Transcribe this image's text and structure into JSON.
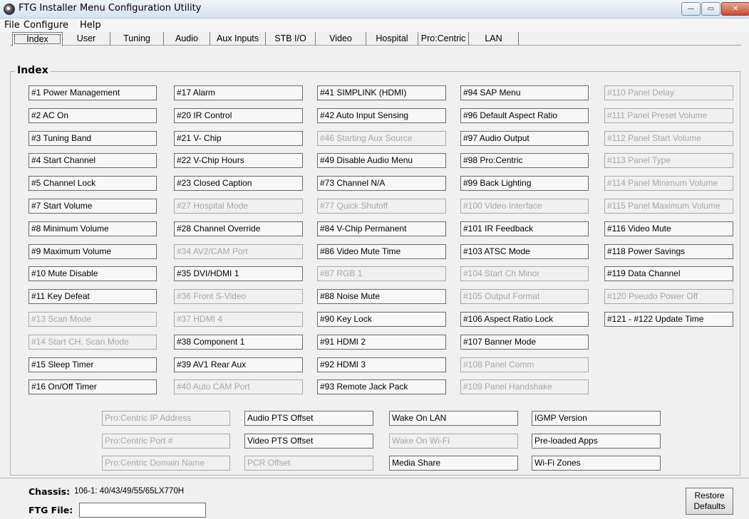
{
  "window": {
    "title": "FTG Installer Menu Configuration Utility",
    "min": "—",
    "max": "▭",
    "close": "✕"
  },
  "menu": [
    "File",
    "Configure",
    "Help"
  ],
  "tabs": [
    "Index",
    "User",
    "Tuning",
    "Audio",
    "Aux Inputs",
    "STB I/O",
    "Video",
    "Hospital",
    "Pro:Centric",
    "LAN"
  ],
  "group_title": "Index",
  "columns": [
    [
      {
        "label": "#1 Power Management",
        "enabled": true
      },
      {
        "label": "#2 AC On",
        "enabled": true
      },
      {
        "label": "#3 Tuning Band",
        "enabled": true
      },
      {
        "label": "#4 Start Channel",
        "enabled": true
      },
      {
        "label": "#5 Channel Lock",
        "enabled": true
      },
      {
        "label": "#7 Start Volume",
        "enabled": true
      },
      {
        "label": "#8 Minimum Volume",
        "enabled": true
      },
      {
        "label": "#9 Maximum Volume",
        "enabled": true
      },
      {
        "label": "#10 Mute Disable",
        "enabled": true
      },
      {
        "label": "#11 Key Defeat",
        "enabled": true
      },
      {
        "label": "#13 Scan Mode",
        "enabled": false
      },
      {
        "label": "#14 Start CH, Scan Mode",
        "enabled": false
      },
      {
        "label": "#15 Sleep Timer",
        "enabled": true
      },
      {
        "label": "#16 On/Off Timer",
        "enabled": true
      }
    ],
    [
      {
        "label": "#17 Alarm",
        "enabled": true
      },
      {
        "label": "#20 IR Control",
        "enabled": true
      },
      {
        "label": "#21 V- Chip",
        "enabled": true
      },
      {
        "label": "#22 V-Chip Hours",
        "enabled": true
      },
      {
        "label": "#23 Closed Caption",
        "enabled": true
      },
      {
        "label": "#27 Hospital Mode",
        "enabled": false
      },
      {
        "label": "#28 Channel Override",
        "enabled": true
      },
      {
        "label": "#34 AV2/CAM Port",
        "enabled": false
      },
      {
        "label": "#35 DVI/HDMI 1",
        "enabled": true
      },
      {
        "label": "#36 Front S-Video",
        "enabled": false
      },
      {
        "label": "#37 HDMI 4",
        "enabled": false
      },
      {
        "label": "#38 Component 1",
        "enabled": true
      },
      {
        "label": "#39 AV1 Rear Aux",
        "enabled": true
      },
      {
        "label": "#40 Auto CAM Port",
        "enabled": false
      }
    ],
    [
      {
        "label": "#41 SIMPLINK (HDMI)",
        "enabled": true
      },
      {
        "label": "#42 Auto Input Sensing",
        "enabled": true
      },
      {
        "label": "#46 Starting Aux Source",
        "enabled": false
      },
      {
        "label": "#49 Disable Audio Menu",
        "enabled": true
      },
      {
        "label": "#73 Channel N/A",
        "enabled": true
      },
      {
        "label": "#77 Quick Shutoff",
        "enabled": false
      },
      {
        "label": "#84 V-Chip Permanent",
        "enabled": true
      },
      {
        "label": "#86 Video Mute Time",
        "enabled": true
      },
      {
        "label": "#87 RGB 1",
        "enabled": false
      },
      {
        "label": "#88 Noise Mute",
        "enabled": true
      },
      {
        "label": "#90 Key Lock",
        "enabled": true
      },
      {
        "label": "#91 HDMI 2",
        "enabled": true
      },
      {
        "label": "#92 HDMI 3",
        "enabled": true
      },
      {
        "label": "#93 Remote Jack Pack",
        "enabled": true
      }
    ],
    [
      {
        "label": "#94 SAP Menu",
        "enabled": true
      },
      {
        "label": "#96 Default Aspect Ratio",
        "enabled": true
      },
      {
        "label": "#97 Audio Output",
        "enabled": true
      },
      {
        "label": "#98 Pro:Centric",
        "enabled": true
      },
      {
        "label": "#99 Back Lighting",
        "enabled": true
      },
      {
        "label": "#100 Video Interface",
        "enabled": false
      },
      {
        "label": "#101 IR Feedback",
        "enabled": true
      },
      {
        "label": "#103 ATSC Mode",
        "enabled": true
      },
      {
        "label": "#104 Start Ch Minor",
        "enabled": false
      },
      {
        "label": "#105 Output Format",
        "enabled": false
      },
      {
        "label": "#106 Aspect Ratio Lock",
        "enabled": true
      },
      {
        "label": "#107 Banner Mode",
        "enabled": true
      },
      {
        "label": "#108 Panel Comm",
        "enabled": false
      },
      {
        "label": "#109 Panel Handshake",
        "enabled": false
      }
    ],
    [
      {
        "label": "#110 Panel Delay",
        "enabled": false
      },
      {
        "label": "#111 Panel Preset Volume",
        "enabled": false
      },
      {
        "label": "#112 Panel Start Volume",
        "enabled": false
      },
      {
        "label": "#113 Panel Type",
        "enabled": false
      },
      {
        "label": "#114 Panel Minimum Volume",
        "enabled": false
      },
      {
        "label": "#115 Panel Maximum Volume",
        "enabled": false
      },
      {
        "label": "#116 Video Mute",
        "enabled": true
      },
      {
        "label": "#118 Power Savings",
        "enabled": true
      },
      {
        "label": "#119 Data Channel",
        "enabled": true
      },
      {
        "label": "#120 Pseudo Power Off",
        "enabled": false
      },
      {
        "label": "#121 - #122 Update Time",
        "enabled": true
      }
    ]
  ],
  "extra_columns": [
    [
      {
        "label": "Pro:Centric IP Address",
        "enabled": false
      },
      {
        "label": "Pro:Centric Port #",
        "enabled": false
      },
      {
        "label": "Pro:Centric Domain Name",
        "enabled": false
      }
    ],
    [
      {
        "label": "Audio PTS Offset",
        "enabled": true
      },
      {
        "label": "Video PTS Offset",
        "enabled": true
      },
      {
        "label": "PCR Offset",
        "enabled": false
      }
    ],
    [
      {
        "label": "Wake On LAN",
        "enabled": true
      },
      {
        "label": "Wake On  Wi-Fi",
        "enabled": false
      },
      {
        "label": "Media Share",
        "enabled": true
      }
    ],
    [
      {
        "label": "IGMP Version",
        "enabled": true
      },
      {
        "label": "Pre-loaded Apps",
        "enabled": true
      },
      {
        "label": "Wi-Fi Zones",
        "enabled": true
      }
    ]
  ],
  "footer": {
    "chassis_label": "Chassis:",
    "chassis_value": "106-1: 40/43/49/55/65LX770H",
    "ftg_label": "FTG File:",
    "ftg_value": "",
    "restore_line1": "Restore",
    "restore_line2": "Defaults"
  }
}
